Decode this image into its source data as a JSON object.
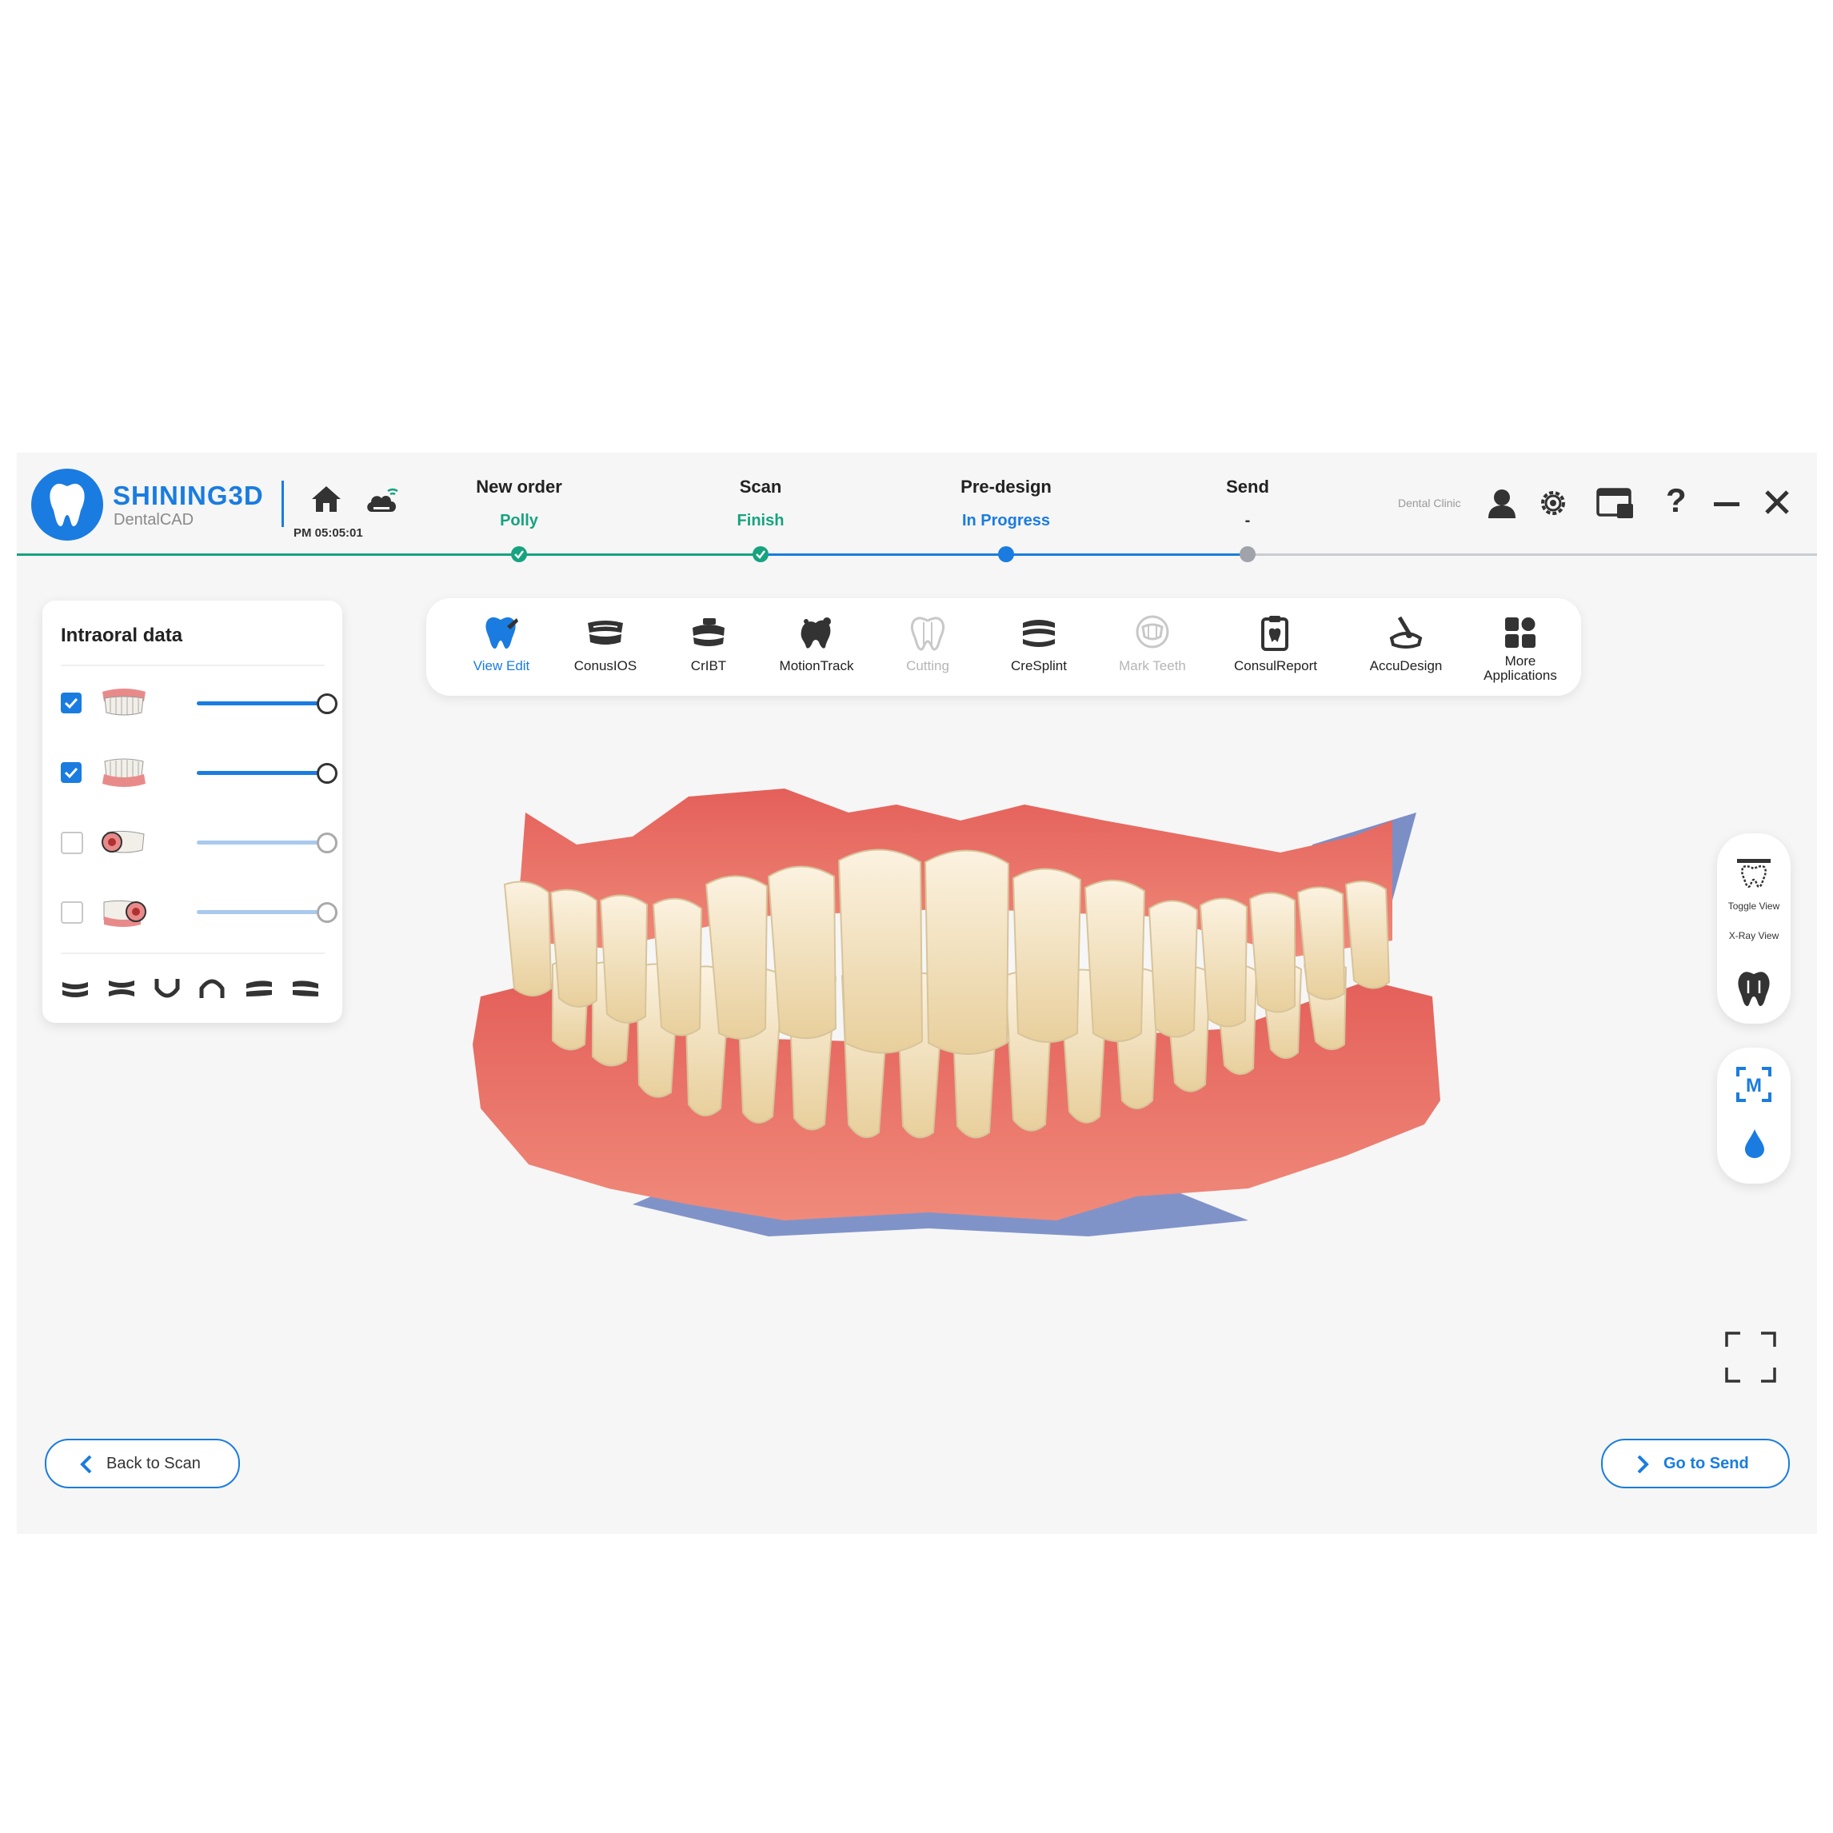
{
  "header": {
    "brand": "SHINING3D",
    "brand_sub": "DentalCAD",
    "time": "PM 05:05:01",
    "clinic": "Dental Clinic"
  },
  "steps": [
    {
      "title": "New order",
      "status": "Polly",
      "state": "done"
    },
    {
      "title": "Scan",
      "status": "Finish",
      "state": "done"
    },
    {
      "title": "Pre-design",
      "status": "In Progress",
      "state": "current"
    },
    {
      "title": "Send",
      "status": "-",
      "state": "pending"
    }
  ],
  "panel": {
    "title": "Intraoral data",
    "layers": [
      {
        "name": "upper-jaw",
        "checked": true,
        "opacity": 1.0
      },
      {
        "name": "lower-jaw",
        "checked": true,
        "opacity": 1.0
      },
      {
        "name": "upper-jaw-detail",
        "checked": false,
        "opacity": 1.0
      },
      {
        "name": "lower-jaw-detail",
        "checked": false,
        "opacity": 1.0
      }
    ]
  },
  "toolbar": [
    {
      "label": "View Edit",
      "icon": "view-edit-icon",
      "state": "active"
    },
    {
      "label": "ConusIOS",
      "icon": "conusios-icon",
      "state": "normal"
    },
    {
      "label": "CrIBT",
      "icon": "cribt-icon",
      "state": "normal"
    },
    {
      "label": "MotionTrack",
      "icon": "motiontrack-icon",
      "state": "normal"
    },
    {
      "label": "Cutting",
      "icon": "cutting-icon",
      "state": "disabled"
    },
    {
      "label": "CreSplint",
      "icon": "cresplint-icon",
      "state": "normal"
    },
    {
      "label": "Mark Teeth",
      "icon": "mark-teeth-icon",
      "state": "disabled"
    },
    {
      "label": "ConsulReport",
      "icon": "consulreport-icon",
      "state": "normal"
    },
    {
      "label": "AccuDesign",
      "icon": "accudesign-icon",
      "state": "normal"
    },
    {
      "label1": "More",
      "label2": "Applications",
      "icon": "more-applications-icon",
      "state": "normal"
    }
  ],
  "side_tools": {
    "toggle_view": "Toggle View",
    "xray_view": "X-Ray View"
  },
  "buttons": {
    "back": "Back to Scan",
    "next": "Go to Send"
  },
  "colors": {
    "accent": "#1a7ce0",
    "done": "#16a37f",
    "pending": "#a0a4aa"
  }
}
